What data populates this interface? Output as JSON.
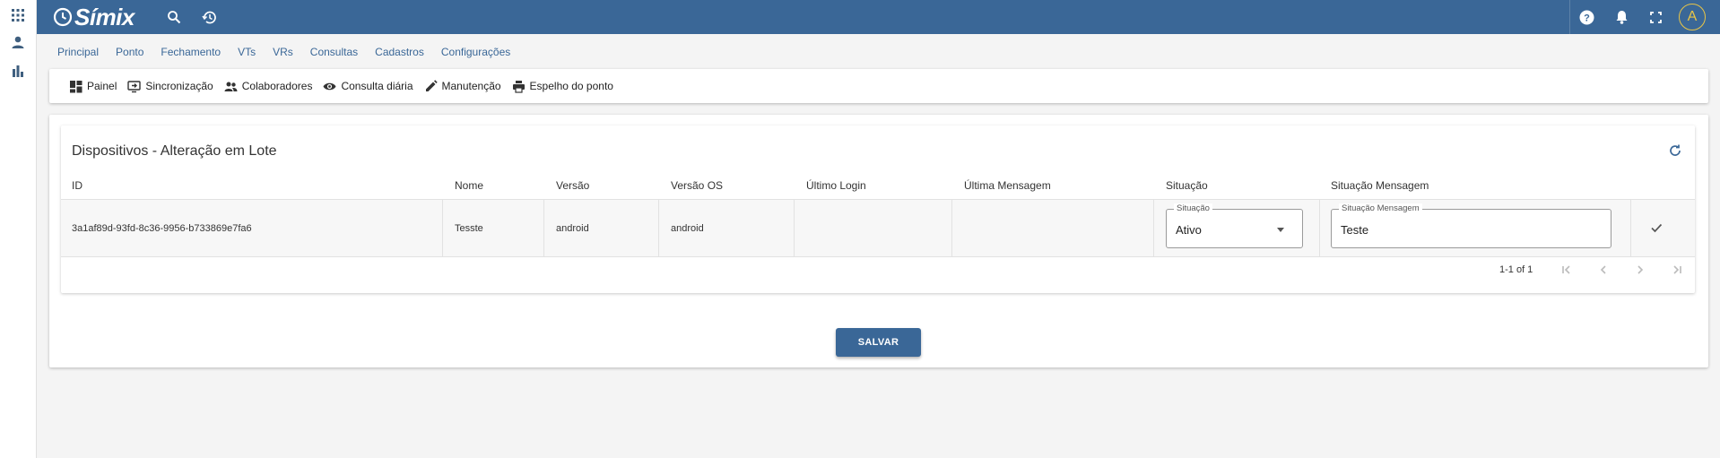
{
  "topbar": {
    "logo_text": "Símix",
    "avatar_letter": "A",
    "bg_color": "#3a6797",
    "icons": [
      "search-icon",
      "history-icon",
      "help-icon",
      "notifications-icon",
      "fullscreen-icon"
    ]
  },
  "rail": {
    "icons": [
      "apps-icon",
      "person-icon",
      "bar-chart-icon"
    ]
  },
  "main_menu": [
    "Principal",
    "Ponto",
    "Fechamento",
    "VTs",
    "VRs",
    "Consultas",
    "Cadastros",
    "Configurações"
  ],
  "sub_menu": [
    {
      "label": "Painel",
      "icon": "dashboard-icon"
    },
    {
      "label": "Sincronização",
      "icon": "sync-screen-icon"
    },
    {
      "label": "Colaboradores",
      "icon": "people-icon"
    },
    {
      "label": "Consulta diária",
      "icon": "eye-icon"
    },
    {
      "label": "Manutenção",
      "icon": "pencil-icon"
    },
    {
      "label": "Espelho do ponto",
      "icon": "print-icon"
    }
  ],
  "card": {
    "title": "Dispositivos - Alteração em Lote",
    "columns": [
      "ID",
      "Nome",
      "Versão",
      "Versão OS",
      "Último Login",
      "Última Mensagem",
      "Situação",
      "Situação Mensagem"
    ],
    "rows": [
      {
        "id": "3a1af89d-93fd-8c36-9956-b733869e7fa6",
        "nome": "Tesste",
        "versao": "android",
        "versao_os": "android",
        "ultimo_login": "",
        "ultima_mensagem": "",
        "situacao_label": "Situação",
        "situacao_value": "Ativo",
        "situacao_msg_label": "Situação Mensagem",
        "situacao_msg_value": "Teste"
      }
    ],
    "pagination": "1-1 of 1",
    "save_label": "SALVAR"
  }
}
